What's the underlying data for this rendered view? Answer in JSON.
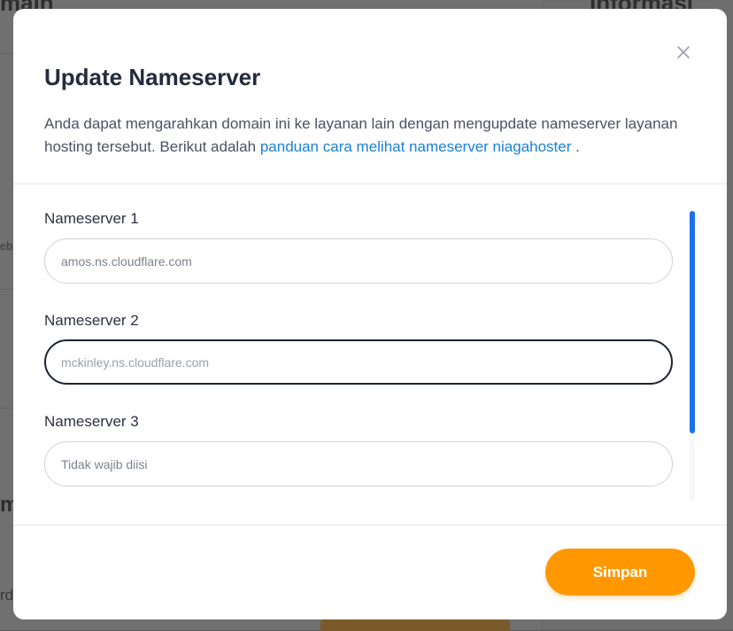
{
  "background": {
    "left_heading": "main",
    "right_heading": "Informasi WH",
    "fragment_1": "eb",
    "fragment_2": "m",
    "fragment_3": "rd"
  },
  "modal": {
    "title": "Update Nameserver",
    "description_text": "Anda dapat mengarahkan domain ini ke layanan lain dengan mengupdate nameserver layanan hosting tersebut. Berikut adalah ",
    "description_link": "panduan cara melihat nameserver niagahoster",
    "description_end": " .",
    "close_icon": "close-icon",
    "fields": [
      {
        "label": "Nameserver 1",
        "value": "",
        "placeholder": "amos.ns.cloudflare.com"
      },
      {
        "label": "Nameserver 2",
        "value": "mckinley.ns.cloudflare.com",
        "placeholder": ""
      },
      {
        "label": "Nameserver 3",
        "value": "",
        "placeholder": "Tidak wajib diisi"
      }
    ],
    "save_label": "Simpan",
    "colors": {
      "accent": "#ff9800",
      "link": "#1a80d6",
      "scrollbar": "#1a73e8"
    }
  }
}
